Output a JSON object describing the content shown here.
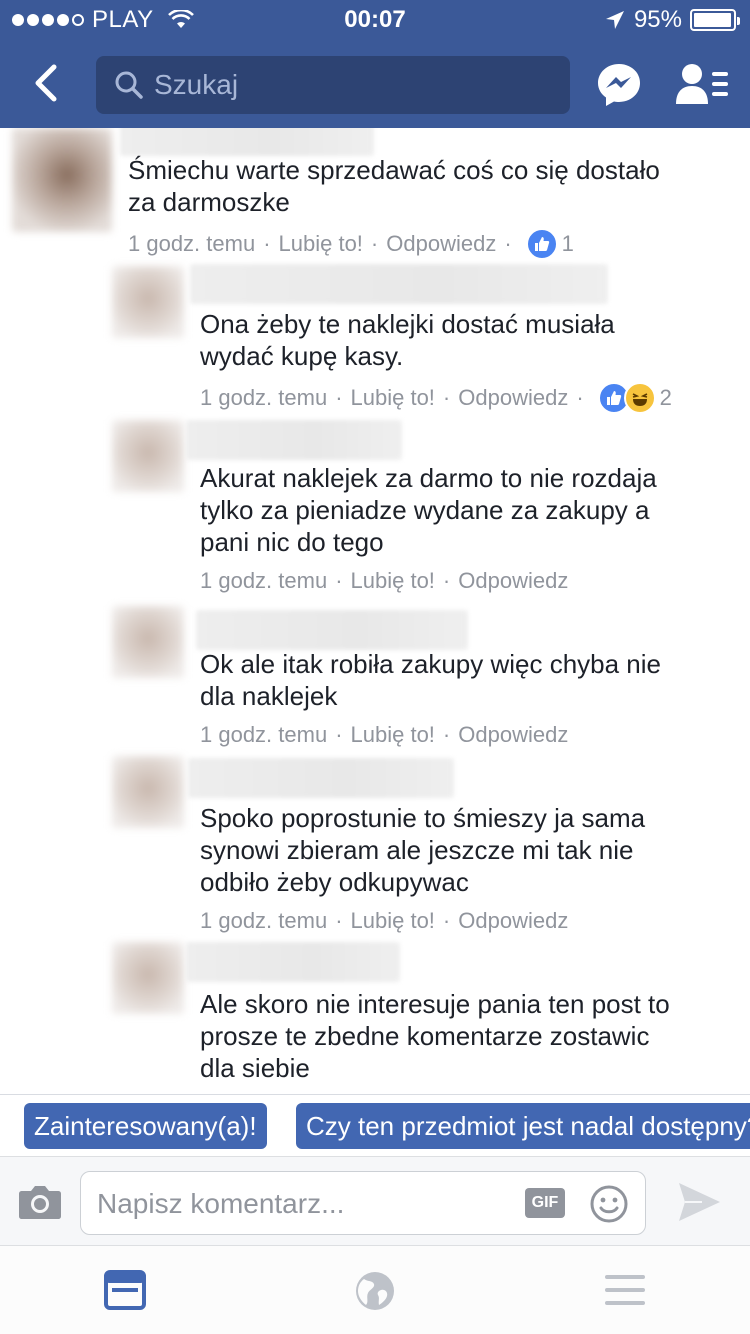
{
  "status_bar": {
    "carrier": "PLAY",
    "time": "00:07",
    "battery": "95%"
  },
  "header": {
    "search_placeholder": "Szukaj"
  },
  "comments": [
    {
      "text": "Śmiechu warte sprzedawać coś co się dostało\nza darmoszke",
      "time": "1 godz. temu",
      "like": "Lubię to!",
      "reply": "Odpowiedz",
      "reactions": [
        "like"
      ],
      "reaction_count": "1"
    },
    {
      "text": "Ona żeby te naklejki dostać musiała\nwydać kupę kasy.",
      "time": "1 godz. temu",
      "like": "Lubię to!",
      "reply": "Odpowiedz",
      "reactions": [
        "like",
        "haha"
      ],
      "reaction_count": "2"
    },
    {
      "text": "Akurat naklejek za darmo to nie rozdaja\ntylko za pieniadze wydane za zakupy a\npani nic do tego",
      "time": "1 godz. temu",
      "like": "Lubię to!",
      "reply": "Odpowiedz"
    },
    {
      "text": "Ok ale itak robiła zakupy więc chyba nie\ndla naklejek",
      "time": "1 godz. temu",
      "like": "Lubię to!",
      "reply": "Odpowiedz"
    },
    {
      "text": "Spoko poprostunie to śmieszy ja sama\nsynowi zbieram ale jeszcze mi tak nie\nodbiło żeby odkupywac",
      "time": "1 godz. temu",
      "like": "Lubię to!",
      "reply": "Odpowiedz"
    },
    {
      "text": "Ale skoro nie interesuje pania ten post to\nprosze te zbedne komentarze zostawic\ndla siebie"
    }
  ],
  "quick_replies": [
    "Zainteresowany(a)!",
    "Czy ten przedmiot jest nadal dostępny?"
  ],
  "composer": {
    "placeholder": "Napisz komentarz...",
    "gif_label": "GIF"
  },
  "colors": {
    "brand": "#3b5998",
    "chip": "#4267b2",
    "meta": "#90949c",
    "tab_active": "#4267b2",
    "tab_inactive": "#bec2c9"
  },
  "icons": {
    "back": "chevron-left-icon",
    "search": "search-icon",
    "messenger": "messenger-icon",
    "friends": "friend-requests-icon",
    "camera": "camera-icon",
    "emoji": "emoji-icon",
    "send": "send-icon",
    "tabs": [
      "news-feed-icon",
      "globe-icon",
      "menu-icon"
    ]
  }
}
